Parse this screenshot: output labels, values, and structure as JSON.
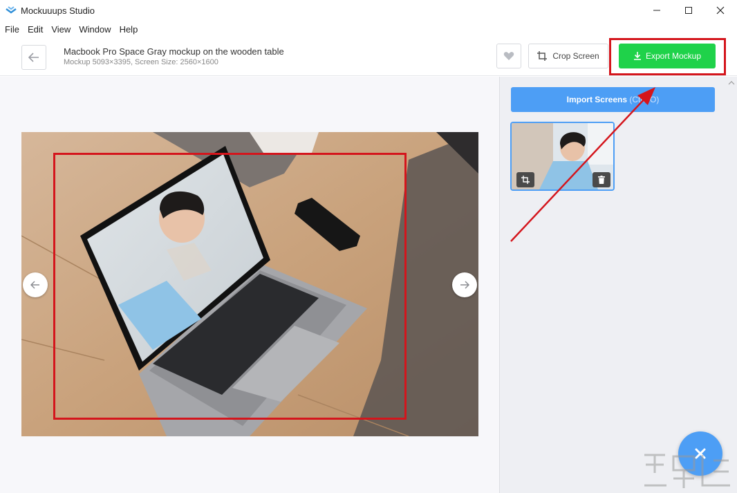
{
  "window": {
    "title": "Mockuuups Studio",
    "logo_icon": "mockuuups-logo-icon",
    "controls": [
      "minimize-icon",
      "maximize-icon",
      "close-icon"
    ]
  },
  "menu": [
    "File",
    "Edit",
    "View",
    "Window",
    "Help"
  ],
  "header": {
    "mockup_title": "Macbook Pro Space Gray mockup on the wooden table",
    "mockup_meta": "Mockup 5093×3395, Screen Size: 2560×1600",
    "crop_label": "Crop Screen",
    "export_label": "Export Mockup"
  },
  "sidebar": {
    "import_label": "Import Screens",
    "import_shortcut": "(Ctrl+O)"
  },
  "colors": {
    "export_green": "#1fd24a",
    "accent_blue": "#4d9ef5",
    "annotation_red": "#d4151c"
  }
}
